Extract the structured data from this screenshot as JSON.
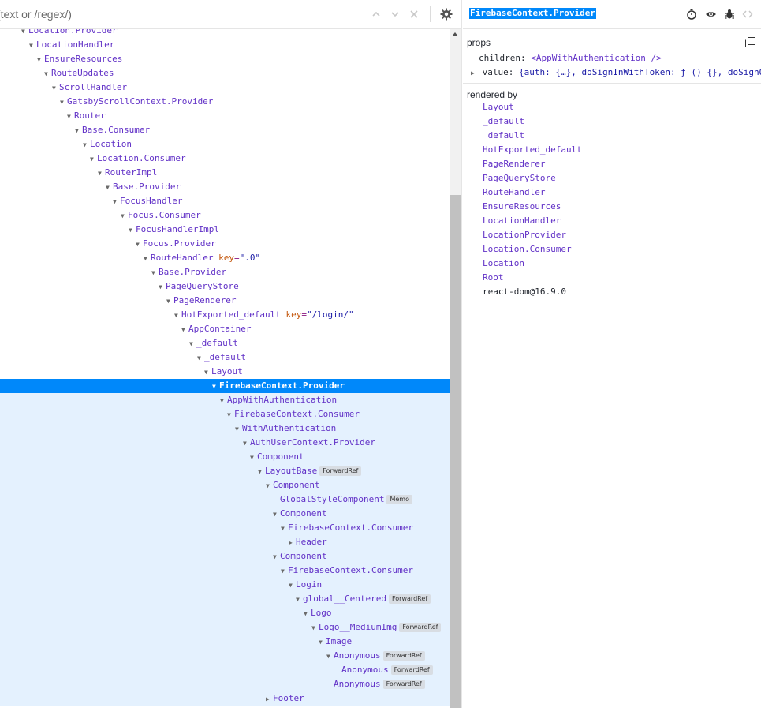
{
  "search": {
    "placeholder": "(text or /regex/)"
  },
  "toolbar": {
    "prev_icon": "chevron-up-icon",
    "next_icon": "chevron-down-icon",
    "clear_icon": "close-icon",
    "settings_icon": "gear-icon"
  },
  "tree": [
    {
      "depth": 2,
      "name": "Location.Provider",
      "expanded": true
    },
    {
      "depth": 3,
      "name": "LocationHandler",
      "expanded": true
    },
    {
      "depth": 4,
      "name": "EnsureResources",
      "expanded": true
    },
    {
      "depth": 5,
      "name": "RouteUpdates",
      "expanded": true
    },
    {
      "depth": 6,
      "name": "ScrollHandler",
      "expanded": true
    },
    {
      "depth": 7,
      "name": "GatsbyScrollContext.Provider",
      "expanded": true
    },
    {
      "depth": 8,
      "name": "Router",
      "expanded": true
    },
    {
      "depth": 9,
      "name": "Base.Consumer",
      "expanded": true
    },
    {
      "depth": 10,
      "name": "Location",
      "expanded": true
    },
    {
      "depth": 11,
      "name": "Location.Consumer",
      "expanded": true
    },
    {
      "depth": 12,
      "name": "RouterImpl",
      "expanded": true
    },
    {
      "depth": 13,
      "name": "Base.Provider",
      "expanded": true
    },
    {
      "depth": 14,
      "name": "FocusHandler",
      "expanded": true
    },
    {
      "depth": 15,
      "name": "Focus.Consumer",
      "expanded": true
    },
    {
      "depth": 16,
      "name": "FocusHandlerImpl",
      "expanded": true
    },
    {
      "depth": 17,
      "name": "Focus.Provider",
      "expanded": true
    },
    {
      "depth": 18,
      "name": "RouteHandler",
      "expanded": true,
      "key": "\".0\""
    },
    {
      "depth": 19,
      "name": "Base.Provider",
      "expanded": true
    },
    {
      "depth": 20,
      "name": "PageQueryStore",
      "expanded": true
    },
    {
      "depth": 21,
      "name": "PageRenderer",
      "expanded": true
    },
    {
      "depth": 22,
      "name": "HotExported_default",
      "expanded": true,
      "key": "\"/login/\""
    },
    {
      "depth": 23,
      "name": "AppContainer",
      "expanded": true
    },
    {
      "depth": 24,
      "name": "_default",
      "expanded": true
    },
    {
      "depth": 25,
      "name": "_default",
      "expanded": true
    },
    {
      "depth": 26,
      "name": "Layout",
      "expanded": true
    },
    {
      "depth": 27,
      "name": "FirebaseContext.Provider",
      "expanded": true,
      "selected": true
    },
    {
      "depth": 28,
      "name": "AppWithAuthentication",
      "expanded": true,
      "sub": true
    },
    {
      "depth": 29,
      "name": "FirebaseContext.Consumer",
      "expanded": true,
      "sub": true
    },
    {
      "depth": 30,
      "name": "WithAuthentication",
      "expanded": true,
      "sub": true
    },
    {
      "depth": 31,
      "name": "AuthUserContext.Provider",
      "expanded": true,
      "sub": true
    },
    {
      "depth": 32,
      "name": "Component",
      "expanded": true,
      "sub": true
    },
    {
      "depth": 33,
      "name": "LayoutBase",
      "expanded": true,
      "sub": true,
      "badge": "ForwardRef"
    },
    {
      "depth": 34,
      "name": "Component",
      "expanded": true,
      "sub": true
    },
    {
      "depth": 35,
      "name": "GlobalStyleComponent",
      "expanded": null,
      "sub": true,
      "badge": "Memo"
    },
    {
      "depth": 35,
      "name": "Component",
      "expanded": true,
      "sub": true
    },
    {
      "depth": 36,
      "name": "FirebaseContext.Consumer",
      "expanded": true,
      "sub": true
    },
    {
      "depth": 37,
      "name": "Header",
      "expanded": false,
      "sub": true
    },
    {
      "depth": 35,
      "name": "Component",
      "expanded": true,
      "sub": true
    },
    {
      "depth": 36,
      "name": "FirebaseContext.Consumer",
      "expanded": true,
      "sub": true
    },
    {
      "depth": 37,
      "name": "Login",
      "expanded": true,
      "sub": true
    },
    {
      "depth": 38,
      "name": "global__Centered",
      "expanded": true,
      "sub": true,
      "badge": "ForwardRef"
    },
    {
      "depth": 39,
      "name": "Logo",
      "expanded": true,
      "sub": true
    },
    {
      "depth": 40,
      "name": "Logo__MediumImg",
      "expanded": true,
      "sub": true,
      "badge": "ForwardRef"
    },
    {
      "depth": 41,
      "name": "Image",
      "expanded": true,
      "sub": true
    },
    {
      "depth": 42,
      "name": "Anonymous",
      "expanded": true,
      "sub": true,
      "badge": "ForwardRef"
    },
    {
      "depth": 43,
      "name": "Anonymous",
      "expanded": null,
      "sub": true,
      "badge": "ForwardRef"
    },
    {
      "depth": 42,
      "name": "Anonymous",
      "expanded": null,
      "sub": true,
      "badge": "ForwardRef"
    },
    {
      "depth": 34,
      "name": "Footer",
      "expanded": false,
      "sub": true
    }
  ],
  "inspector": {
    "selected_name": "FirebaseContext.Provider",
    "icons": [
      "stopwatch-icon",
      "eye-icon",
      "bug-icon",
      "code-icon"
    ],
    "props_title": "props",
    "props": [
      {
        "key": "children:",
        "value": "<AppWithAuthentication />",
        "expandable": false
      },
      {
        "key": "value:",
        "value": "{auth: {…}, doSignInWithToken: ƒ () {}, doSignOut:…",
        "expandable": true
      }
    ],
    "rendered_by_title": "rendered by",
    "rendered_by": [
      "Layout",
      "_default",
      "_default",
      "HotExported_default",
      "PageRenderer",
      "PageQueryStore",
      "RouteHandler",
      "EnsureResources",
      "LocationHandler",
      "LocationProvider",
      "Location.Consumer",
      "Location",
      "Root"
    ],
    "renderer_version": "react-dom@16.9.0"
  },
  "colors": {
    "selection": "#0088fa",
    "subtree": "#e4f1fe",
    "component_name": "#6232c7",
    "key_attr": "#c55a11"
  }
}
